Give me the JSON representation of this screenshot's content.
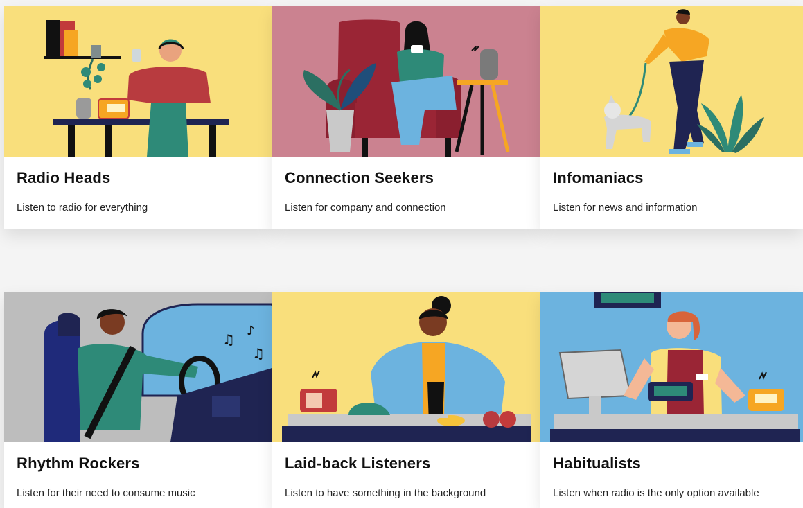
{
  "cards": [
    {
      "title": "Radio Heads",
      "desc": "Listen to radio for everything",
      "bg": "#f9df7c",
      "icon": "person-headphones-illustration"
    },
    {
      "title": "Connection Seekers",
      "desc": "Listen for company and connection",
      "bg": "#cb8290",
      "icon": "person-armchair-illustration"
    },
    {
      "title": "Infomaniacs",
      "desc": "Listen for news and information",
      "bg": "#f9df7c",
      "icon": "person-dog-walk-illustration"
    },
    {
      "title": "Rhythm Rockers",
      "desc": "Listen for their need to consume music",
      "bg": "#bdbdbd",
      "icon": "person-driving-illustration"
    },
    {
      "title": "Laid-back Listeners",
      "desc": "Listen to have something in the background",
      "bg": "#f9df7c",
      "icon": "person-cooking-illustration"
    },
    {
      "title": "Habitualists",
      "desc": "Listen when radio is the only option available",
      "bg": "#6cb3df",
      "icon": "person-cashier-illustration"
    }
  ]
}
